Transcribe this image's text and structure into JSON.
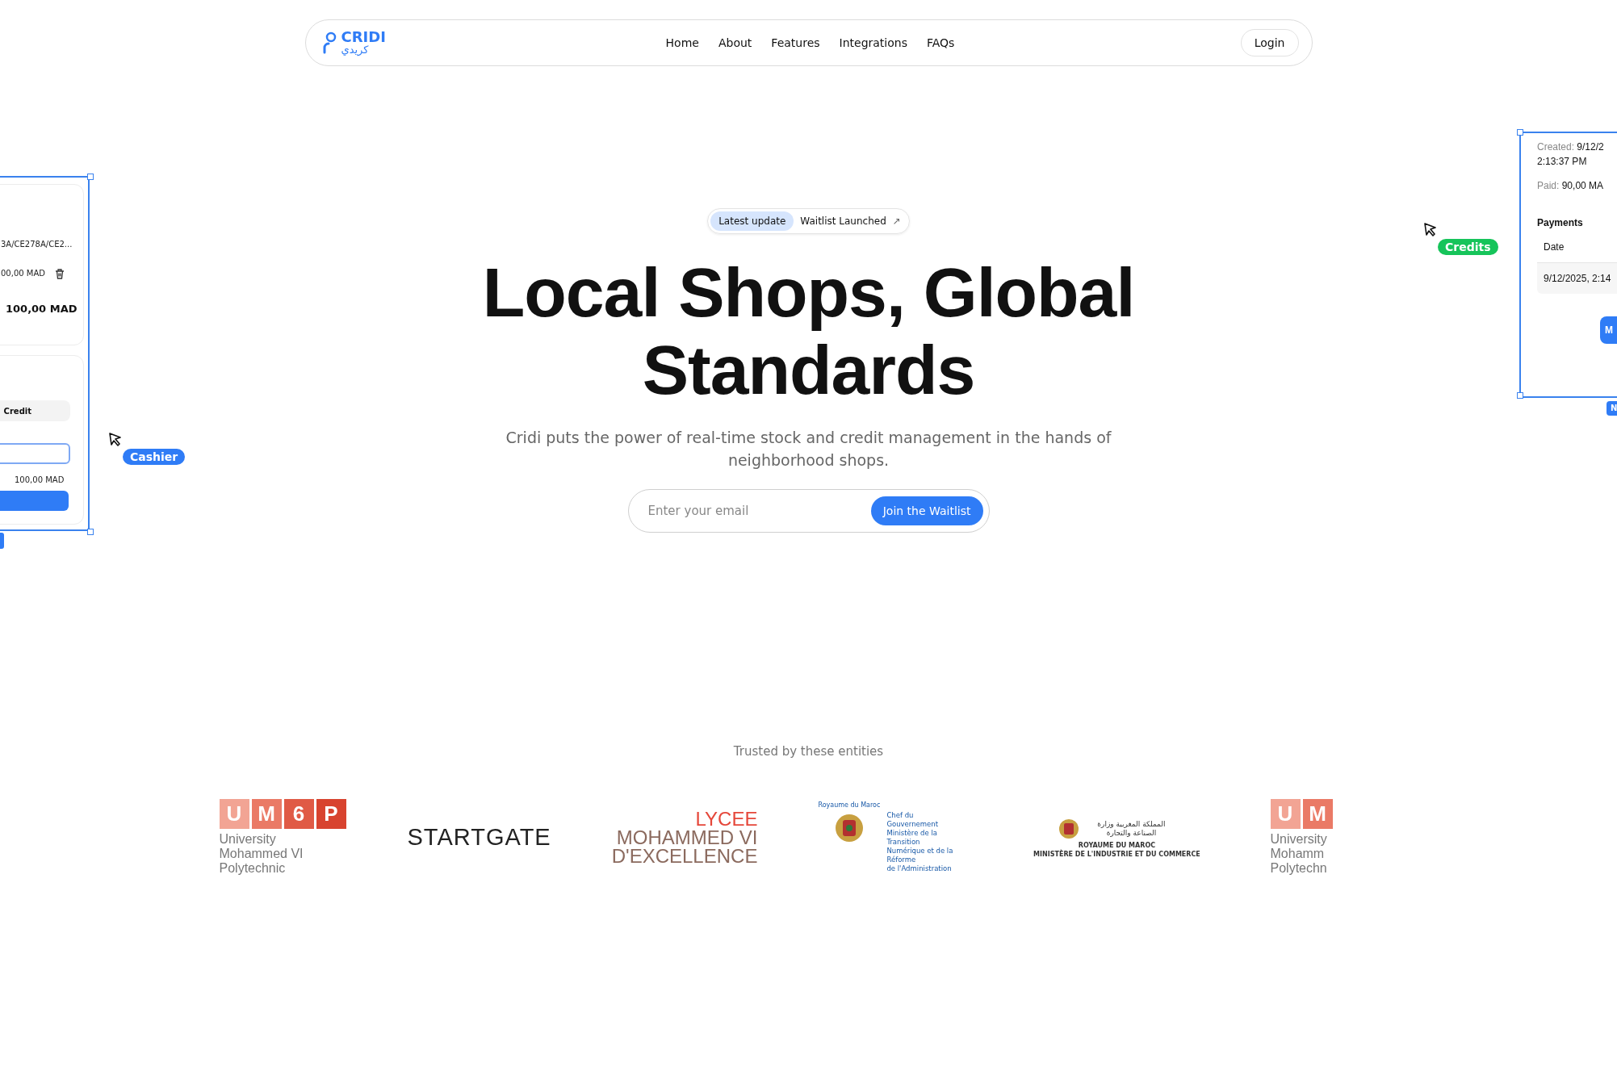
{
  "nav": {
    "logo": {
      "latin": "CRIDI",
      "arabic": "كريدي"
    },
    "links": [
      "Home",
      "About",
      "Features",
      "Integrations",
      "FAQs"
    ],
    "login": "Login"
  },
  "hero": {
    "badge": {
      "tag": "Latest update",
      "text": "Waitlist Launched",
      "arrow": "↗"
    },
    "title_lines": [
      "Local Shops, Global",
      "Standards"
    ],
    "subtitle": "Cridi puts the power of real-time stock and credit management in the hands of neighborhood shops.",
    "email": {
      "placeholder": "Enter your email",
      "button": "Join the Waitlist"
    }
  },
  "left_panel": {
    "ref": "3A/CE278A/CE2...",
    "line_total": "00,00 MAD",
    "total": "100,00 MAD",
    "method": "Credit",
    "amount": "100,00 MAD"
  },
  "right_panel": {
    "created_label": "Created:",
    "created_value": "9/12/2",
    "created_time": "2:13:37 PM",
    "paid_label": "Paid:",
    "paid_value": "90,00 MA",
    "payments_title": "Payments",
    "column": "Date",
    "row": "9/12/2025, 2:14",
    "button": "M",
    "tag": "N"
  },
  "cursors": [
    {
      "label": "Cashier",
      "color": "#2f7cf6"
    },
    {
      "label": "Credits",
      "color": "#16c45a"
    }
  ],
  "trusted": {
    "title": "Trusted by these entities",
    "logos": [
      {
        "kind": "um6p",
        "letters": [
          "U",
          "M",
          "6",
          "P"
        ],
        "lines": [
          "University",
          "Mohammed VI",
          "Polytechnic"
        ]
      },
      {
        "kind": "startgate",
        "text": "STARTGATE"
      },
      {
        "kind": "lycee",
        "lines": [
          "LYCEE",
          "MOHAMMED VI",
          "D'EXCELLENCE"
        ]
      },
      {
        "kind": "gov",
        "top": "Royaume du Maroc",
        "lines": [
          "Chef du Gouvernement",
          "Ministère de la Transition",
          "Numérique et de la Réforme",
          "de l'Administration"
        ]
      },
      {
        "kind": "ministry",
        "arabic": "المملكة المغربية وزارة الصناعة والتجارة",
        "lines": [
          "ROYAUME DU MAROC",
          "MINISTÈRE DE L'INDUSTRIE ET DU COMMERCE"
        ]
      },
      {
        "kind": "um6p",
        "letters": [
          "U",
          "M"
        ],
        "lines": [
          "University",
          "Mohamm",
          "Polytechn"
        ]
      }
    ]
  }
}
